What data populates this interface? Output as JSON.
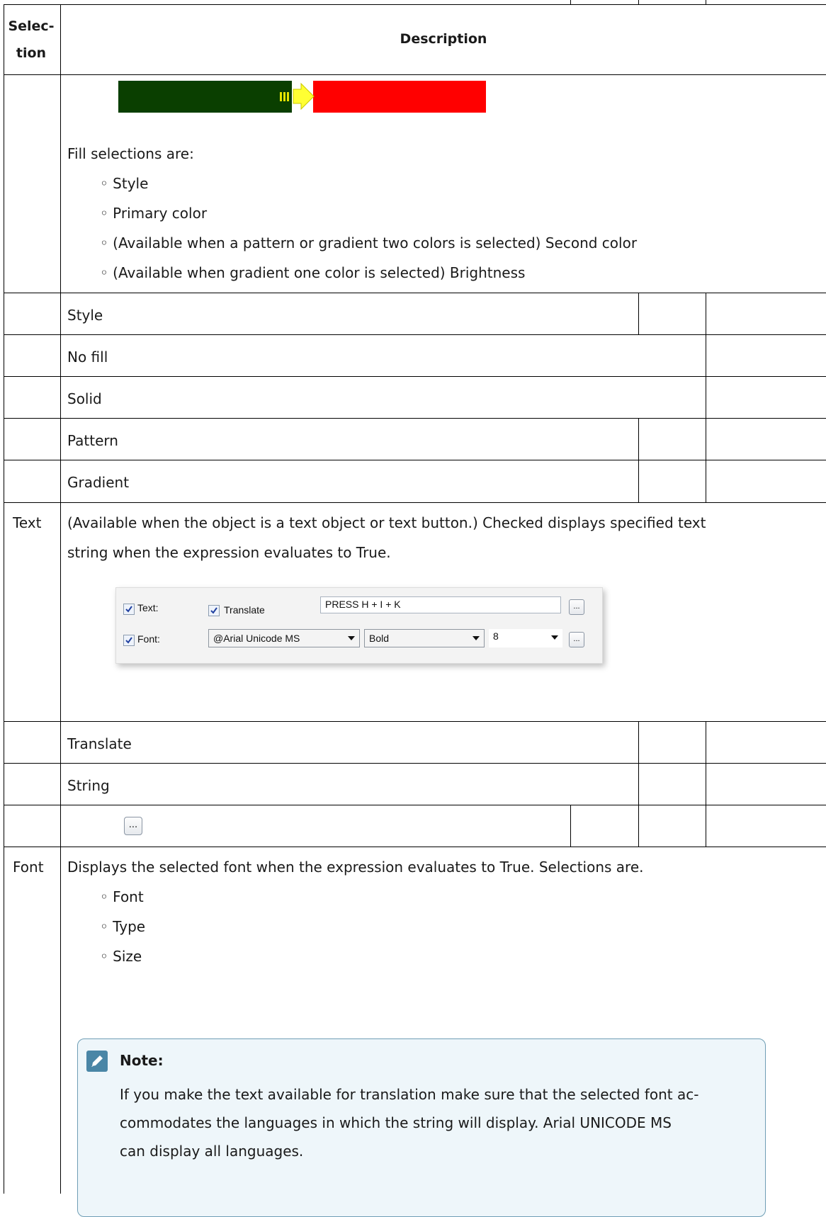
{
  "table": {
    "header_selection": "Selec- tion",
    "header_selection_l1": "Selec-",
    "header_selection_l2": "tion",
    "header_description": "Description"
  },
  "fill": {
    "preview_colors": {
      "left": "#0a3f00",
      "arrow": "#ffff33",
      "right": "#ff0000"
    },
    "intro": "Fill selections are:",
    "bullets": [
      "Style",
      "Primary color",
      "(Available when a pattern or gradient two colors is selected) Second color",
      "(Available when gradient one color is selected) Brightness"
    ],
    "subrows": [
      "Style",
      "No fill",
      "Solid",
      "Pattern",
      "Gradient"
    ]
  },
  "text_row": {
    "label": "Text",
    "description_l1": "(Available when the object is a text object or text button.) Checked displays specified text",
    "description_l2": "string when the expression evaluates to True.",
    "panel": {
      "text_label": "Text:",
      "translate_label": "Translate",
      "string_value": "PRESS H + I + K",
      "font_label": "Font:",
      "font_value": "@Arial Unicode MS",
      "type_value": "Bold",
      "size_value": "8",
      "ellipsis": "..."
    },
    "subrows": [
      "Translate",
      "String"
    ],
    "ellipsis_button": "..."
  },
  "font_row": {
    "label": "Font",
    "description": "Displays the selected font when the expression evaluates to True. Selections are.",
    "bullets": [
      "Font",
      "Type",
      "Size"
    ]
  },
  "note": {
    "title": "Note:",
    "body_l1": "If you make the text available for translation make sure that the selected font ac-",
    "body_l2": "commodates the languages in which the string will display. Arial UNICODE MS",
    "body_l3": "can display all languages."
  },
  "colors": {
    "note_border": "#6f9eb5",
    "note_bg": "#eef6fa",
    "note_icon": "#4a86a6"
  }
}
